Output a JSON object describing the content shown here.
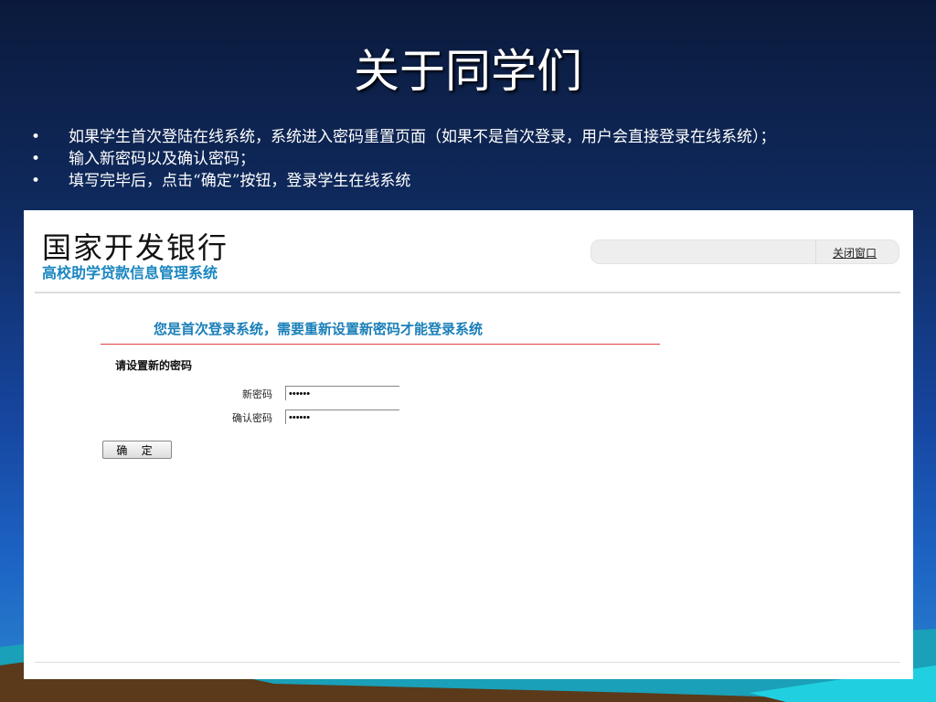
{
  "slide": {
    "title": "关于同学们",
    "bullets": [
      "如果学生首次登陆在线系统，系统进入密码重置页面（如果不是首次登录，用户会直接登录在线系统）；",
      "输入新密码以及确认密码；",
      "填写完毕后，点击“确定”按钮，登录学生在线系统"
    ],
    "bullet_char": "•"
  },
  "app": {
    "bank_name": "国家开发银行",
    "system_name": "高校助学贷款信息管理系统",
    "close_window": "关闭窗口",
    "notice": "您是首次登录系统，需要重新设置新密码才能登录系统",
    "section": "请设置新的密码",
    "new_password_label": "新密码",
    "new_password_value": "••••••",
    "confirm_password_label": "确认密码",
    "confirm_password_value": "••••••",
    "confirm_button": "确 定"
  }
}
